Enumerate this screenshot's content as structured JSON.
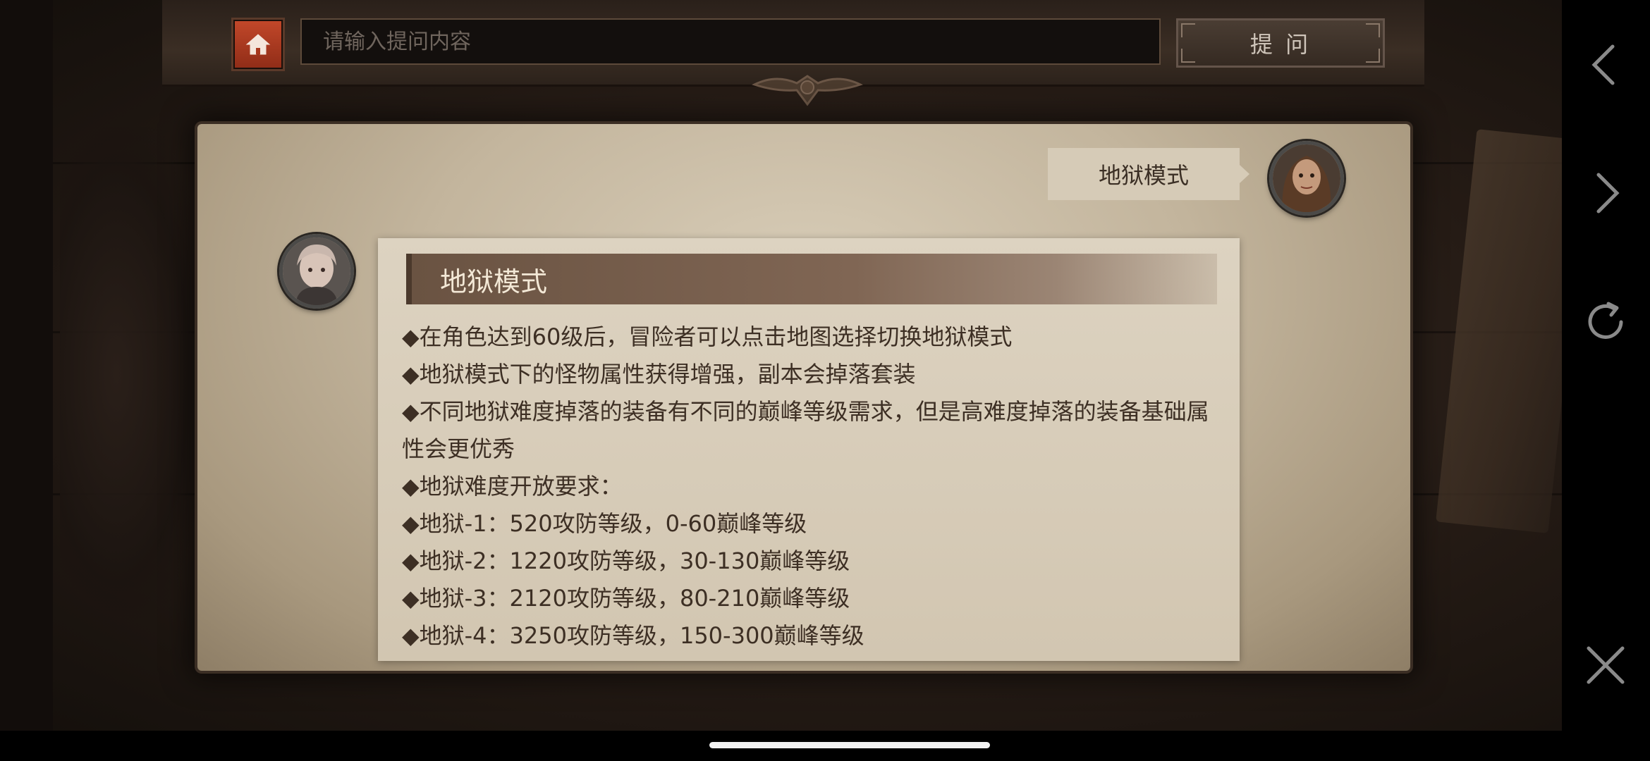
{
  "top_bar": {
    "search_placeholder": "请输入提问内容",
    "ask_label": "提 问"
  },
  "chat": {
    "user_question": "地狱模式",
    "answer": {
      "title": "地狱模式",
      "lines": [
        "◆在角色达到60级后，冒险者可以点击地图选择切换地狱模式",
        "◆地狱模式下的怪物属性获得增强，副本会掉落套装",
        "◆不同地狱难度掉落的装备有不同的巅峰等级需求，但是高难度掉落的装备基础属性会更优秀",
        "◆地狱难度开放要求：",
        "◆地狱-1：520攻防等级，0-60巅峰等级",
        "◆地狱-2：1220攻防等级，30-130巅峰等级",
        "◆地狱-3：2120攻防等级，80-210巅峰等级",
        "◆地狱-4：3250攻防等级，150-300巅峰等级"
      ]
    }
  },
  "colors": {
    "accent_red": "#b33e22",
    "parchment": "#cfc3ad",
    "title_band": "#6a5342"
  },
  "icons": {
    "home": "home-icon",
    "back": "chevron-left-icon",
    "forward": "chevron-right-icon",
    "refresh": "refresh-icon",
    "close": "close-icon"
  }
}
